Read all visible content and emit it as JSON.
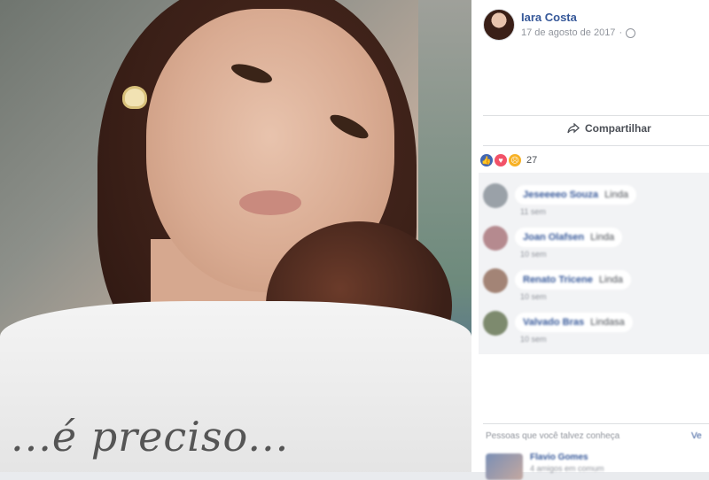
{
  "post": {
    "author": "Iara Costa",
    "date": "17 de agosto de 2017",
    "separator": "·"
  },
  "actions": {
    "share_label": "Compartilhar"
  },
  "reactions": {
    "count": "27",
    "types": [
      "like-icon",
      "love-icon",
      "sad-icon"
    ]
  },
  "comments": [
    {
      "name": "Jeseeeeo Souza",
      "text": "Linda",
      "time": "11 sem"
    },
    {
      "name": "Joan Olafsen",
      "text": "Linda",
      "time": "10 sem"
    },
    {
      "name": "Renato Tricene",
      "text": "Linda",
      "time": "10 sem"
    },
    {
      "name": "Valvado Bras",
      "text": "Lindasa",
      "time": "10 sem"
    }
  ],
  "people_you_may_know": {
    "title": "Pessoas que você talvez conheça",
    "see_all": "Ve",
    "first": {
      "name": "Flavio Gomes",
      "sub": "4 amigos em comum"
    }
  },
  "photo": {
    "shirt_text": "...é preciso..."
  },
  "colors": {
    "link": "#365899",
    "like": "#4267b2",
    "love": "#f25268",
    "sad": "#f7b125"
  }
}
